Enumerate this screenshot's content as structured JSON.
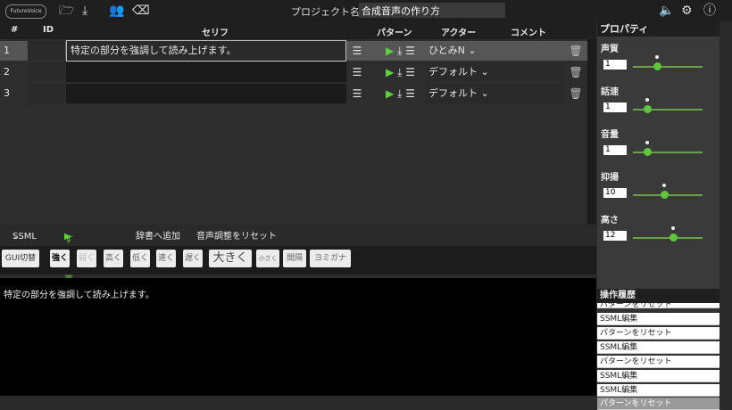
{
  "header": {
    "logo": "FutureVoice",
    "project_label": "プロジェクト名",
    "project_name": "合成音声の作り方"
  },
  "table": {
    "columns": [
      "#",
      "ID",
      "セリフ",
      "パターン",
      "アクター",
      "コメント"
    ],
    "rows": [
      {
        "num": "1",
        "serif": "特定の部分を強調して読み上げます。",
        "actor": "ひとみN"
      },
      {
        "num": "2",
        "serif": "",
        "actor": "デフォルト"
      },
      {
        "num": "3",
        "serif": "",
        "actor": "デフォルト"
      }
    ]
  },
  "properties": {
    "title": "プロパティ",
    "items": [
      {
        "label": "声質",
        "value": "1",
        "level": 0.35
      },
      {
        "label": "話速",
        "value": "1",
        "level": 0.2
      },
      {
        "label": "音量",
        "value": "1",
        "level": 0.2
      },
      {
        "label": "抑揚",
        "value": "10",
        "level": 0.45
      },
      {
        "label": "高さ",
        "value": "12",
        "level": 0.58
      }
    ]
  },
  "toolbar2": {
    "ssml": "SSML",
    "play_all": "すべて再生",
    "add_dict": "辞書へ追加",
    "reset_voice": "音声調整をリセット"
  },
  "ssml_buttons": [
    "GUI切替",
    "強く",
    "弱く",
    "高く",
    "低く",
    "速く",
    "遅く",
    "大きく",
    "小さく",
    "間隔",
    "ヨミガナ"
  ],
  "editor": {
    "text": "特定の部分を強調して読み上げます。"
  },
  "history": {
    "title": "操作履歴",
    "items": [
      "パターンをリセット",
      "SSML編集",
      "パターンをリセット",
      "SSML編集",
      "パターンをリセット",
      "SSML編集",
      "SSML編集",
      "パターンをリセット"
    ]
  },
  "colors": {
    "accent": "#5fd03a"
  }
}
